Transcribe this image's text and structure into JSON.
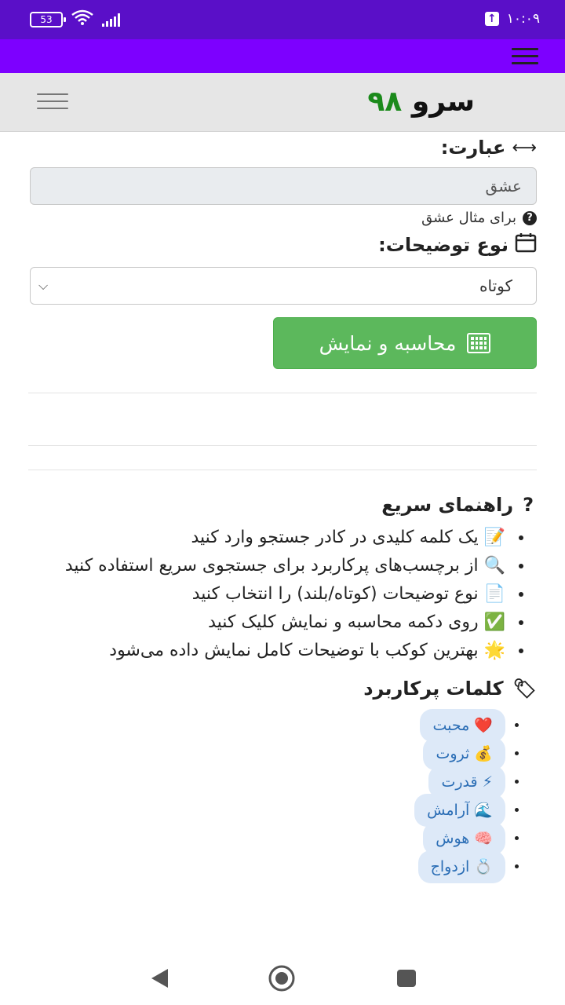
{
  "status_bar": {
    "battery": "53",
    "time": "۱۰:۰۹"
  },
  "brand": {
    "name": "سرو",
    "number": "۹۸"
  },
  "form": {
    "phrase_label": "عبارت:",
    "phrase_icon": "arrows-horizontal-icon",
    "phrase_value": "عشق",
    "phrase_hint": "برای مثال عشق",
    "type_label": "نوع توضیحات:",
    "type_icon": "calendar-icon",
    "type_selected": "کوتاه",
    "submit_label": "محاسبه و نمایش"
  },
  "guide": {
    "title": "راهنمای سریع",
    "items": [
      {
        "emoji": "📝",
        "text": "یک کلمه کلیدی در کادر جستجو وارد کنید"
      },
      {
        "emoji": "🔍",
        "text": "از برچسب‌های پرکاربرد برای جستجوی سریع استفاده کنید"
      },
      {
        "emoji": "📄",
        "text": "نوع توضیحات (کوتاه/بلند) را انتخاب کنید"
      },
      {
        "emoji": "✅",
        "text": "روی دکمه محاسبه و نمایش کلیک کنید"
      },
      {
        "emoji": "🌟",
        "text": "بهترین کوکب با توضیحات کامل نمایش داده می‌شود"
      }
    ]
  },
  "tags": {
    "title": "کلمات پرکاربرد",
    "items": [
      {
        "emoji": "❤️",
        "label": "محبت"
      },
      {
        "emoji": "💰",
        "label": "ثروت"
      },
      {
        "emoji": "⚡",
        "label": "قدرت"
      },
      {
        "emoji": "🌊",
        "label": "آرامش"
      },
      {
        "emoji": "🧠",
        "label": "هوش"
      },
      {
        "emoji": "💍",
        "label": "ازدواج"
      }
    ]
  },
  "colors": {
    "status_bar": "#5a0fc8",
    "top_nav": "#7d00ff",
    "brand_number": "#1b8a1b",
    "button": "#5cb85c",
    "tag_bg": "#dde9f8",
    "tag_text": "#2a6db5"
  }
}
